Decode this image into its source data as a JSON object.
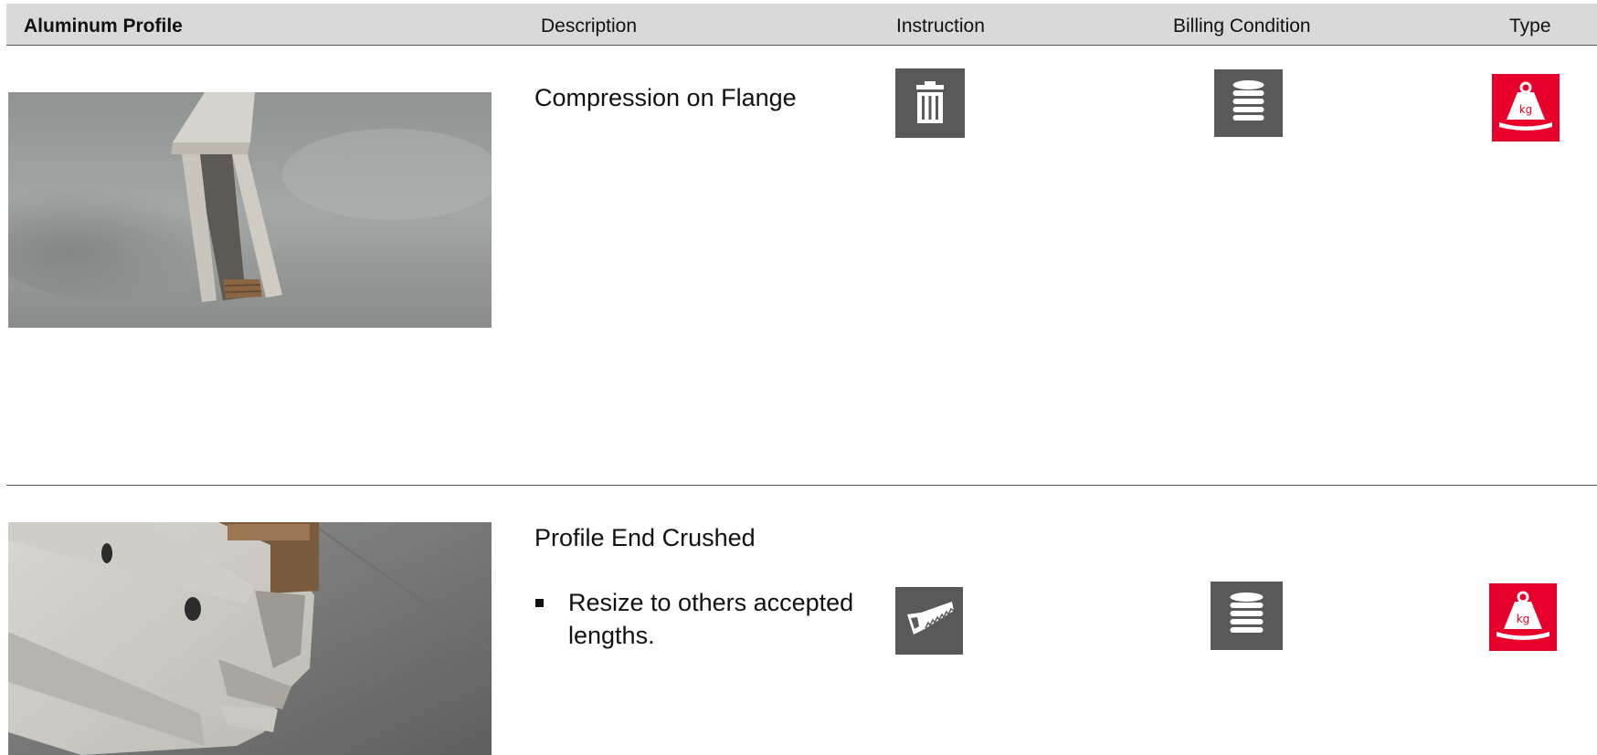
{
  "header": {
    "col_profile": "Aluminum Profile",
    "col_description": "Description",
    "col_instruction": "Instruction",
    "col_billing": "Billing Condition",
    "col_type": "Type"
  },
  "rows": [
    {
      "title": "Compression on Flange",
      "instruction_icon": "trash-icon",
      "billing_icon": "coin-stack-icon",
      "type_icon": "weight-kg-icon"
    },
    {
      "title": "Profile End Crushed",
      "bullet": "Resize to others accepted lengths.",
      "instruction_icon": "saw-icon",
      "billing_icon": "coin-stack-icon",
      "type_icon": "weight-kg-icon"
    }
  ],
  "icons": {
    "kg_label": "kg"
  },
  "colors": {
    "header_bg": "#d9d9d9",
    "icon_gray": "#595959",
    "type_red": "#e8002b"
  }
}
